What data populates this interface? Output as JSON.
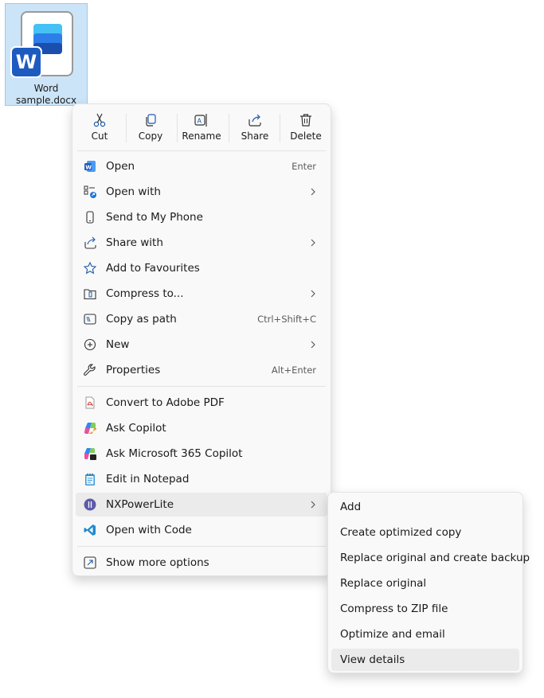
{
  "file": {
    "name_line1": "Word",
    "name_line2": "sample.docx",
    "badge_letter": "W"
  },
  "toolbar": [
    {
      "label": "Cut",
      "icon": "scissors-icon"
    },
    {
      "label": "Copy",
      "icon": "copy-icon"
    },
    {
      "label": "Rename",
      "icon": "rename-icon"
    },
    {
      "label": "Share",
      "icon": "share-icon"
    },
    {
      "label": "Delete",
      "icon": "trash-icon"
    }
  ],
  "menu_items": [
    {
      "label": "Open",
      "shortcut": "Enter",
      "icon": "word-icon"
    },
    {
      "label": "Open with",
      "icon": "open-with-icon",
      "submenu": true
    },
    {
      "label": "Send to My Phone",
      "icon": "phone-icon"
    },
    {
      "label": "Share with",
      "icon": "share-with-icon",
      "submenu": true
    },
    {
      "label": "Add to Favourites",
      "icon": "star-icon"
    },
    {
      "label": "Compress to...",
      "icon": "zip-icon",
      "submenu": true
    },
    {
      "label": "Copy as path",
      "shortcut": "Ctrl+Shift+C",
      "icon": "copy-path-icon"
    },
    {
      "label": "New",
      "icon": "plus-circle-icon",
      "submenu": true
    },
    {
      "label": "Properties",
      "shortcut": "Alt+Enter",
      "icon": "wrench-icon"
    },
    {
      "label": "Convert to Adobe PDF",
      "icon": "adobe-pdf-icon"
    },
    {
      "label": "Ask Copilot",
      "icon": "copilot-icon"
    },
    {
      "label": "Ask Microsoft 365 Copilot",
      "icon": "m365-copilot-icon"
    },
    {
      "label": "Edit in Notepad",
      "icon": "notepad-icon"
    },
    {
      "label": "NXPowerLite",
      "icon": "nxpowerlite-icon",
      "submenu": true
    },
    {
      "label": "Open with Code",
      "icon": "vscode-icon"
    },
    {
      "label": "Show more options",
      "icon": "external-icon"
    }
  ],
  "submenu": {
    "items": [
      "Add",
      "Create optimized copy",
      "Replace original and create backup",
      "Replace original",
      "Compress to ZIP file",
      "Optimize and email",
      "View details"
    ]
  },
  "colors": {
    "word_blue": "#1d5bc0",
    "selection": "#cce4f7",
    "menu_bg": "#f9f9f9",
    "hover": "#ebebeb"
  }
}
